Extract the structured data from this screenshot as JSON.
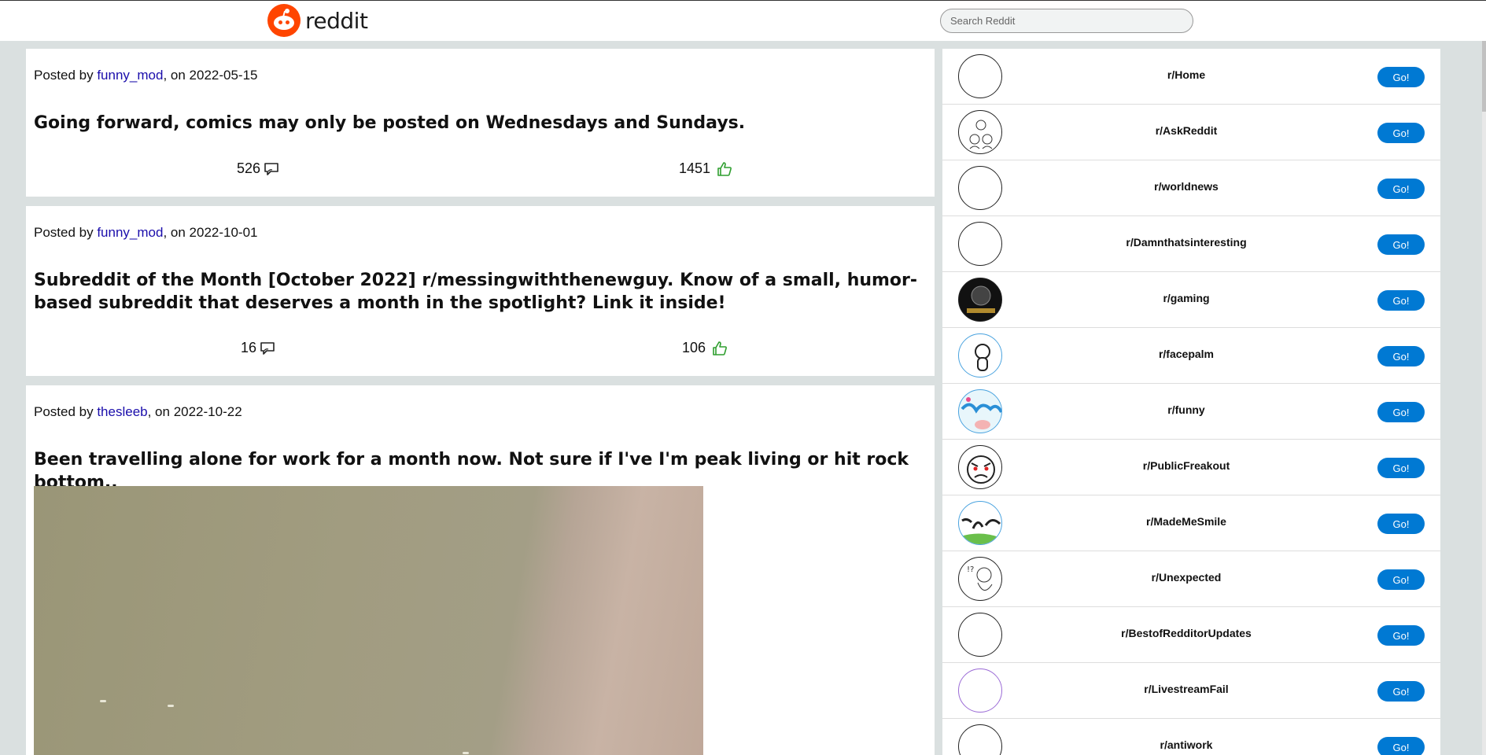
{
  "header": {
    "logo_text": "reddit",
    "search_placeholder": "Search Reddit"
  },
  "posts": [
    {
      "posted_prefix": "Posted by ",
      "author": "funny_mod",
      "posted_suffix": ", on 2022-05-15",
      "title": "Going forward, comics may only be posted on Wednesdays and Sundays.",
      "comments": "526",
      "upvotes": "1451"
    },
    {
      "posted_prefix": "Posted by ",
      "author": "funny_mod",
      "posted_suffix": ", on 2022-10-01",
      "title": "Subreddit of the Month [October 2022] r/messingwiththenewguy. Know of a small, humor-based subreddit that deserves a month in the spotlight? Link it inside!",
      "comments": "16",
      "upvotes": "106"
    },
    {
      "posted_prefix": "Posted by ",
      "author": "thesleeb",
      "posted_suffix": ", on 2022-10-22",
      "title": "Been travelling alone for work for a month now. Not sure if I've I'm peak living or hit rock bottom.."
    }
  ],
  "sidebar": {
    "go_label": "Go!",
    "subreddits": [
      {
        "name": "r/Home"
      },
      {
        "name": "r/AskReddit"
      },
      {
        "name": "r/worldnews"
      },
      {
        "name": "r/Damnthatsinteresting"
      },
      {
        "name": "r/gaming"
      },
      {
        "name": "r/facepalm"
      },
      {
        "name": "r/funny"
      },
      {
        "name": "r/PublicFreakout"
      },
      {
        "name": "r/MadeMeSmile"
      },
      {
        "name": "r/Unexpected"
      },
      {
        "name": "r/BestofRedditorUpdates"
      },
      {
        "name": "r/LivestreamFail"
      },
      {
        "name": "r/antiwork"
      }
    ]
  },
  "colors": {
    "brand": "#ff4500",
    "go_button": "#0079d3",
    "link": "#1a0dab",
    "upvote_icon": "#2e9e2e"
  }
}
